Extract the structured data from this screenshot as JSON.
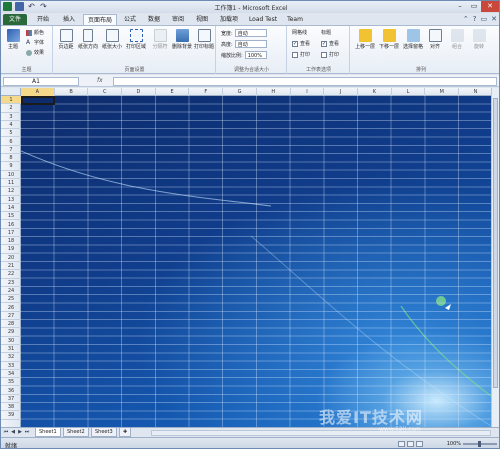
{
  "window": {
    "title": "工作簿1 - Microsoft Excel"
  },
  "tabs": [
    "文件",
    "开始",
    "插入",
    "页面布局",
    "公式",
    "数据",
    "审阅",
    "视图",
    "加载项",
    "Load Test",
    "Team"
  ],
  "active_tab": "页面布局",
  "ribbon": {
    "theme_group": {
      "label": "主题",
      "big_button": "主题",
      "small": [
        "颜色",
        "字体",
        "效果"
      ]
    },
    "page_setup_group": {
      "label": "页面设置",
      "buttons": [
        "页边距",
        "纸张方向",
        "纸张大小",
        "打印区域",
        "分隔符",
        "删除背景",
        "打印标题"
      ],
      "delete_bg_line2": "背景"
    },
    "scale_group": {
      "label": "调整为合适大小",
      "width_label": "宽度:",
      "width_value": "自动",
      "height_label": "高度:",
      "height_value": "自动",
      "scale_label": "缩放比例:",
      "scale_value": "100%"
    },
    "sheet_options_group": {
      "label": "工作表选项",
      "gridlines": "网格线",
      "headings": "标题",
      "view": "查看",
      "print": "打印"
    },
    "arrange_group": {
      "label": "排列",
      "buttons": [
        "上移一层",
        "下移一层",
        "选择窗格",
        "对齐",
        "组合",
        "旋转"
      ]
    }
  },
  "formula_bar": {
    "name_box": "A1",
    "fx": "fx",
    "value": ""
  },
  "columns": [
    "A",
    "B",
    "C",
    "D",
    "E",
    "F",
    "G",
    "H",
    "I",
    "J",
    "K",
    "L",
    "M",
    "N"
  ],
  "rows": [
    "1",
    "2",
    "3",
    "4",
    "5",
    "6",
    "7",
    "8",
    "9",
    "10",
    "11",
    "12",
    "13",
    "14",
    "15",
    "16",
    "17",
    "18",
    "19",
    "20",
    "21",
    "22",
    "23",
    "24",
    "25",
    "26",
    "27",
    "28",
    "29",
    "30",
    "31",
    "32",
    "33",
    "34",
    "35",
    "36",
    "37",
    "38",
    "39"
  ],
  "sheets": [
    "Sheet1",
    "Sheet2",
    "Sheet3"
  ],
  "active_sheet": "Sheet1",
  "status": {
    "text": "就绪",
    "zoom": "100%"
  },
  "watermark": {
    "text": "我爱IT技术网",
    "url": "www.52ij.com"
  },
  "colors": {
    "file_tab": "#2a6a3a",
    "selection": "#f5d98a",
    "background_blue": "#1558b0"
  }
}
